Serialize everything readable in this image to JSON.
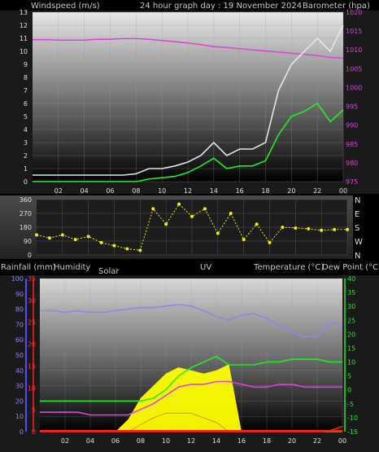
{
  "header": {
    "title": "24 hour graph day : 19 November 2024",
    "left_label": "Windspeed (m/s)",
    "right_label": "Barometer (hpa)"
  },
  "bottom_header": {
    "rainfall": "Rainfall (mm)",
    "humidity": "Humidity",
    "solar": "Solar",
    "uv": "UV",
    "temperature": "Temperature (°C)",
    "dewpoint": "Dew Point (°C)"
  },
  "x_ticks": [
    "02",
    "04",
    "06",
    "08",
    "10",
    "12",
    "14",
    "16",
    "18",
    "20",
    "22",
    "00"
  ],
  "colors": {
    "windspeed": "#e6e6e6",
    "wind_avg": "#22ee22",
    "barometer": "#e040e0",
    "wind_dir": "#f0f000",
    "humidity": "#8888ee",
    "temperature": "#22ee22",
    "dewpoint": "#e040e0",
    "solar": "#ffff00",
    "uv": "#e0a010",
    "rain": "#ff2020"
  },
  "chart_data": [
    {
      "type": "line",
      "name": "wind-barometer",
      "x_hours": [
        0,
        1,
        2,
        3,
        4,
        5,
        6,
        7,
        8,
        9,
        10,
        11,
        12,
        13,
        14,
        15,
        16,
        17,
        18,
        19,
        20,
        21,
        22,
        23,
        24
      ],
      "ylim_left": [
        0,
        13
      ],
      "left_ticks": [
        0,
        1,
        2,
        3,
        4,
        5,
        6,
        7,
        8,
        9,
        10,
        11,
        12,
        13
      ],
      "ylim_right": [
        975,
        1020
      ],
      "right_ticks": [
        975,
        980,
        985,
        990,
        995,
        1000,
        1005,
        1010,
        1015,
        1020
      ],
      "series": [
        {
          "key": "windspeed",
          "values": [
            0.5,
            0.5,
            0.5,
            0.5,
            0.5,
            0.5,
            0.5,
            0.5,
            0.6,
            1.0,
            1.0,
            1.2,
            1.5,
            2.0,
            3.0,
            2.0,
            2.5,
            2.5,
            3.0,
            7.0,
            9.0,
            10.0,
            11.0,
            10.0,
            12.0
          ]
        },
        {
          "key": "wind_avg",
          "values": [
            0,
            0,
            0,
            0,
            0,
            0,
            0,
            0,
            0,
            0.2,
            0.3,
            0.4,
            0.7,
            1.2,
            1.8,
            1.0,
            1.2,
            1.2,
            1.6,
            3.6,
            5.0,
            5.4,
            6.0,
            4.6,
            5.5
          ]
        },
        {
          "key": "barometer",
          "values": [
            1012.7,
            1012.7,
            1012.6,
            1012.6,
            1012.6,
            1012.8,
            1012.8,
            1013.0,
            1013.0,
            1012.8,
            1012.5,
            1012.2,
            1011.8,
            1011.4,
            1010.9,
            1010.6,
            1010.3,
            1010.0,
            1009.7,
            1009.4,
            1009.1,
            1008.8,
            1008.5,
            1008.0,
            1007.8
          ]
        }
      ]
    },
    {
      "type": "scatter",
      "name": "wind-direction",
      "ylim": [
        0,
        360
      ],
      "left_ticks": [
        0,
        90,
        180,
        270,
        360
      ],
      "right_ticks": [
        "N",
        "W",
        "S",
        "E",
        "N"
      ],
      "x_hours": [
        0,
        1,
        2,
        3,
        4,
        5,
        6,
        7,
        8,
        9,
        10,
        11,
        12,
        13,
        14,
        15,
        16,
        17,
        18,
        19,
        20,
        21,
        22,
        23,
        24
      ],
      "series": [
        {
          "key": "wind_dir",
          "values": [
            130,
            110,
            130,
            100,
            120,
            80,
            60,
            40,
            30,
            300,
            200,
            330,
            250,
            300,
            140,
            270,
            100,
            200,
            80,
            180,
            175,
            170,
            160,
            165,
            165
          ]
        }
      ]
    },
    {
      "type": "line",
      "name": "temperature-humidity-solar",
      "x_hours": [
        0,
        1,
        2,
        3,
        4,
        5,
        6,
        7,
        8,
        9,
        10,
        11,
        12,
        13,
        14,
        15,
        16,
        17,
        18,
        19,
        20,
        21,
        22,
        23,
        24
      ],
      "humidity_ticks": [
        0,
        10,
        20,
        30,
        40,
        50,
        60,
        70,
        80,
        90,
        100
      ],
      "humidity_lim": [
        0,
        100
      ],
      "rain_ticks": [
        0,
        5,
        10,
        15,
        20,
        25,
        30,
        35
      ],
      "rain_lim": [
        0,
        35
      ],
      "temp_ticks": [
        -15,
        -10,
        -5,
        0,
        5,
        10,
        15,
        20,
        25,
        30,
        35,
        40
      ],
      "temp_lim": [
        -15,
        40
      ],
      "series": [
        {
          "key": "humidity",
          "values": [
            79,
            79,
            78,
            79,
            78,
            78,
            79,
            80,
            81,
            81,
            82,
            83,
            82,
            79,
            75,
            73,
            76,
            77,
            74,
            69,
            65,
            62,
            62,
            71,
            70
          ]
        },
        {
          "key": "temperature",
          "values": [
            -4,
            -4,
            -4,
            -4,
            -4,
            -4,
            -4,
            -4,
            -4,
            -3,
            0,
            5,
            8,
            10,
            12,
            9,
            9,
            9,
            10,
            10,
            11,
            11,
            11,
            10,
            10
          ]
        },
        {
          "key": "dewpoint",
          "values": [
            -8,
            -8,
            -8,
            -8,
            -9,
            -9,
            -9,
            -9,
            -7,
            -5,
            -2,
            1,
            2,
            2,
            3,
            3,
            2,
            1,
            1,
            2,
            2,
            1,
            1,
            1,
            1
          ]
        },
        {
          "key": "solar",
          "values": [
            0,
            0,
            0,
            0,
            0,
            0,
            0,
            8,
            22,
            30,
            38,
            42,
            40,
            38,
            40,
            44,
            0,
            0,
            0,
            0,
            0,
            0,
            0,
            0,
            0
          ]
        },
        {
          "key": "uv",
          "values": [
            0,
            0,
            0,
            0,
            0,
            0,
            0,
            0,
            1.5,
            3,
            4,
            4,
            4,
            3,
            2,
            0,
            0,
            0,
            0,
            0,
            0,
            0,
            0,
            0,
            0
          ]
        },
        {
          "key": "rain",
          "values": [
            0,
            0,
            0,
            0,
            0,
            0,
            0,
            0,
            0,
            0,
            0,
            0,
            0,
            0,
            0,
            0,
            0,
            0,
            0,
            0,
            0,
            0,
            0,
            0.2,
            1.2
          ]
        }
      ]
    }
  ]
}
